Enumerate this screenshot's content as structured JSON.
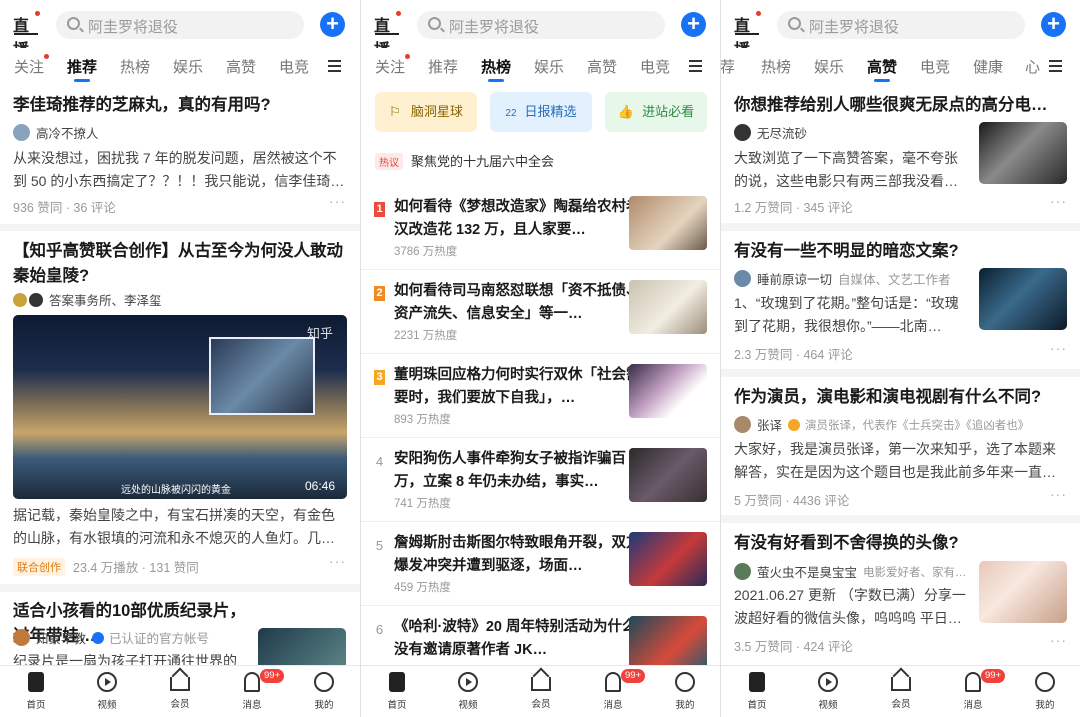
{
  "header": {
    "live_label": "直播",
    "search_placeholder": "阿圭罗将退役",
    "plus_label": "+"
  },
  "nav": {
    "items": [
      "首页",
      "视频",
      "会员",
      "消息",
      "我的"
    ],
    "badge": "99+"
  },
  "panel1": {
    "tabs": [
      "关注",
      "推荐",
      "热榜",
      "娱乐",
      "高赞",
      "电竞"
    ],
    "cards": [
      {
        "title": "李佳琦推荐的芝麻丸，真的有用吗?",
        "author": "高冷不撩人",
        "excerpt": "从来没想过，困扰我 7 年的脱发问题，居然被这个不到 50 的小东西搞定了？？！！我只能说，信李佳琦…",
        "meta": "936 赞同 · 36 评论"
      },
      {
        "title": "【知乎高赞联合创作】从古至今为何没人敢动秦始皇陵?",
        "author": "答案事务所、李泽玺",
        "video_watermark": "知乎",
        "video_caption": "远处的山脉被闪闪的黄金",
        "video_duration": "06:46",
        "excerpt": "据记载，秦始皇陵之中，有宝石拼凑的天空，有金色的山脉，有水银填的河流和永不熄灭的人鱼灯。几…",
        "tag": "联合创作",
        "meta": "23.4 万播放 · 131 赞同"
      },
      {
        "title": "适合小孩看的10部优质纪录片，过年带娃…",
        "author": "知蒙早教",
        "verified": "已认证的官方帐号",
        "excerpt": "纪录片是一扇为孩子打开通往世界的"
      }
    ]
  },
  "panel2": {
    "tabs": [
      "关注",
      "推荐",
      "热榜",
      "娱乐",
      "高赞",
      "电竞"
    ],
    "chips": [
      "脑洞星球",
      "日报精选",
      "进站必看"
    ],
    "chip2_num": "22",
    "hot_badge": "热议",
    "hot_topic": "聚焦党的十九届六中全会",
    "items": [
      {
        "rank": "1",
        "title": "如何看待《梦想改造家》陶磊给农村老汉改造花 132 万，且人家要…",
        "heat": "3786 万热度"
      },
      {
        "rank": "2",
        "title": "如何看待司马南怒怼联想「资不抵债、资产流失、信息安全」等一…",
        "heat": "2231 万热度"
      },
      {
        "rank": "3",
        "title": "董明珠回应格力何时实行双休「社会需要时，我们要放下自我」，…",
        "heat": "893 万热度"
      },
      {
        "rank": "4",
        "title": "安阳狗伤人事件牵狗女子被指诈骗百万，立案 8 年仍未办结，事实…",
        "heat": "741 万热度"
      },
      {
        "rank": "5",
        "title": "詹姆斯肘击斯图尔特致眼角开裂，双方爆发冲突并遭到驱逐，场面…",
        "heat": "459 万热度"
      },
      {
        "rank": "6",
        "title": "《哈利·波特》20 周年特别活动为什么没有邀请原著作者 JK…",
        "heat": ""
      }
    ]
  },
  "panel3": {
    "tabs": [
      "荐",
      "热榜",
      "娱乐",
      "高赞",
      "电竞",
      "健康",
      "心"
    ],
    "cards": [
      {
        "title": "你想推荐给别人哪些很爽无尿点的高分电…",
        "author": "无尽流砂",
        "author_desc": "",
        "excerpt": "大致浏览了一下高赞答案，毫不夸张的说，这些电影只有两三部我没看…",
        "meta": "1.2 万赞同 · 345 评论"
      },
      {
        "title": "有没有一些不明显的暗恋文案?",
        "author": "睡前原谅一切",
        "author_desc": "自媒体、文艺工作者",
        "excerpt": "1、“玫瑰到了花期。”整句话是：“玫瑰到了花期，我很想你。”——北南…",
        "meta": "2.3 万赞同 · 464 评论"
      },
      {
        "title": "作为演员，演电影和演电视剧有什么不同?",
        "author": "张译",
        "author_desc": "演员张译，代表作《士兵突击》《追凶者也》",
        "excerpt": "大家好，我是演员张译，第一次来知乎，选了本题来解答，实在是因为这个题目也是我此前多年来一直…",
        "meta": "5 万赞同 · 4436 评论"
      },
      {
        "title": "有没有好看到不舍得换的头像?",
        "author": "萤火虫不是臭宝宝",
        "author_desc": "电影爱好者、家有…",
        "excerpt": "2021.06.27 更新 （字数已满）分享一波超好看的微信头像，呜呜呜 平日…",
        "meta": "3.5 万赞同 · 424 评论"
      }
    ]
  },
  "colors": {
    "accent": "#1772f6",
    "badge_red": "#f0423a",
    "rank1": "#e94b3c",
    "rank2": "#f08a24",
    "rank3": "#f5a623"
  }
}
